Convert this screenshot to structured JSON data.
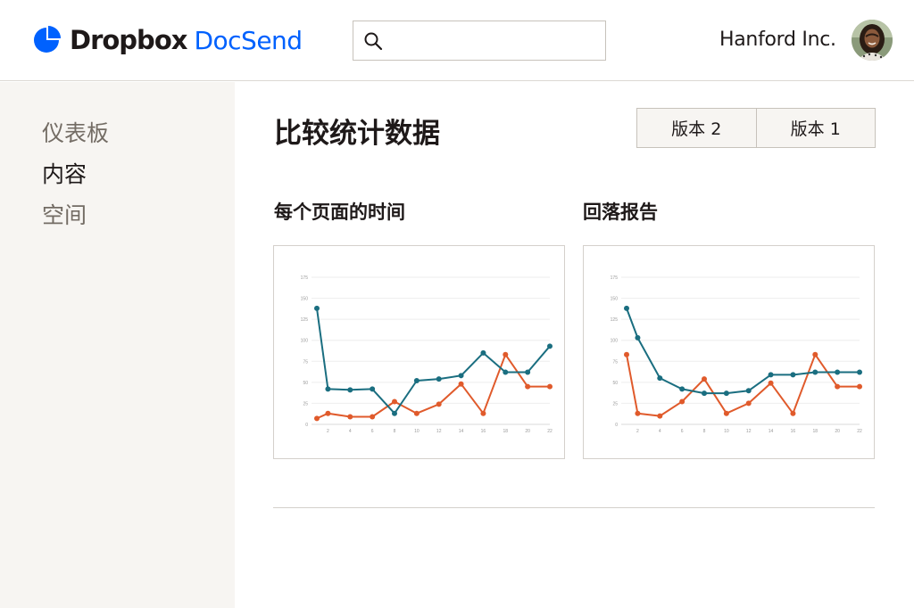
{
  "header": {
    "brand": "Dropbox",
    "product": "DocSend",
    "search_placeholder": "",
    "company": "Hanford Inc."
  },
  "sidebar": {
    "items": [
      {
        "label": "仪表板",
        "active": false
      },
      {
        "label": "内容",
        "active": true
      },
      {
        "label": "空间",
        "active": false
      }
    ]
  },
  "main": {
    "title": "比较统计数据",
    "versions": [
      "版本 2",
      "版本 1"
    ]
  },
  "colors": {
    "brand_blue": "#0061fe",
    "series_teal": "#1a6e80",
    "series_orange": "#e05a2b",
    "sidebar_bg": "#f7f5f2"
  },
  "charts": [
    {
      "title": "每个页面的时间",
      "chart_data": {
        "type": "line",
        "x": [
          1,
          2,
          3,
          4,
          5,
          6,
          7,
          8,
          9,
          10,
          11,
          12,
          13,
          14,
          15,
          16,
          17,
          18,
          19,
          20,
          21,
          22
        ],
        "x_ticks": [
          2,
          4,
          6,
          8,
          10,
          12,
          14,
          16,
          18,
          20,
          22
        ],
        "y_ticks": [
          0,
          25,
          50,
          75,
          100,
          125,
          150,
          175
        ],
        "ylim": [
          0,
          175
        ],
        "grid": true,
        "series": [
          {
            "color": "#1a6e80",
            "points": [
              [
                1,
                138
              ],
              [
                2,
                42
              ],
              [
                4,
                41
              ],
              [
                6,
                42
              ],
              [
                8,
                13
              ],
              [
                10,
                52
              ],
              [
                12,
                54
              ],
              [
                14,
                58
              ],
              [
                16,
                85
              ],
              [
                18,
                62
              ],
              [
                20,
                62
              ],
              [
                22,
                93
              ]
            ]
          },
          {
            "color": "#e05a2b",
            "points": [
              [
                1,
                7
              ],
              [
                2,
                13
              ],
              [
                4,
                9
              ],
              [
                6,
                9
              ],
              [
                8,
                27
              ],
              [
                10,
                13
              ],
              [
                12,
                24
              ],
              [
                14,
                48
              ],
              [
                16,
                13
              ],
              [
                18,
                83
              ],
              [
                20,
                45
              ],
              [
                22,
                45
              ]
            ]
          }
        ]
      }
    },
    {
      "title": "回落报告",
      "chart_data": {
        "type": "line",
        "x": [
          1,
          2,
          3,
          4,
          5,
          6,
          7,
          8,
          9,
          10,
          11,
          12,
          13,
          14,
          15,
          16,
          17,
          18,
          19,
          20,
          21,
          22
        ],
        "x_ticks": [
          2,
          4,
          6,
          8,
          10,
          12,
          14,
          16,
          18,
          20,
          22
        ],
        "y_ticks": [
          0,
          25,
          50,
          75,
          100,
          125,
          150,
          175
        ],
        "ylim": [
          0,
          175
        ],
        "grid": true,
        "series": [
          {
            "color": "#1a6e80",
            "points": [
              [
                1,
                138
              ],
              [
                2,
                103
              ],
              [
                4,
                55
              ],
              [
                6,
                42
              ],
              [
                8,
                37
              ],
              [
                10,
                37
              ],
              [
                12,
                40
              ],
              [
                14,
                59
              ],
              [
                16,
                59
              ],
              [
                18,
                62
              ],
              [
                20,
                62
              ],
              [
                22,
                62
              ]
            ]
          },
          {
            "color": "#e05a2b",
            "points": [
              [
                1,
                83
              ],
              [
                2,
                13
              ],
              [
                4,
                10
              ],
              [
                6,
                27
              ],
              [
                8,
                54
              ],
              [
                10,
                13
              ],
              [
                12,
                25
              ],
              [
                14,
                49
              ],
              [
                16,
                13
              ],
              [
                18,
                83
              ],
              [
                20,
                45
              ],
              [
                22,
                45
              ]
            ]
          }
        ]
      }
    }
  ]
}
